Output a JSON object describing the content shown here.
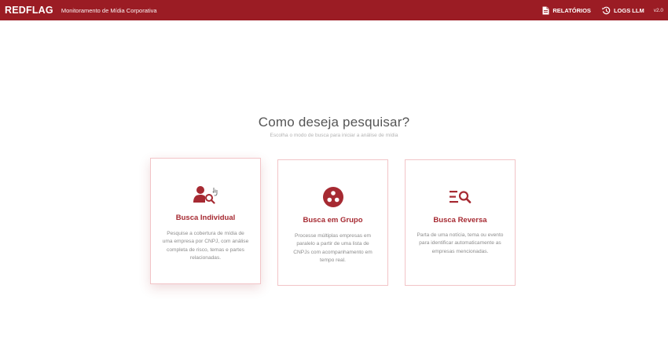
{
  "header": {
    "logo": "REDFLAG",
    "subtitle": "Monitoramento de Mídia Corporativa",
    "nav": [
      {
        "label": "RELATÓRIOS",
        "icon": "document-icon"
      },
      {
        "label": "LOGS LLM",
        "icon": "history-icon"
      }
    ],
    "version": "v2.0"
  },
  "main": {
    "title": "Como deseja pesquisar?",
    "subtitle": "Escolha o modo de busca para iniciar a análise de mídia"
  },
  "cards": [
    {
      "title": "Busca Individual",
      "description": "Pesquise a cobertura de mídia de uma empresa por CNPJ, com análise completa de risco, temas e partes relacionadas.",
      "icon": "user-search-icon"
    },
    {
      "title": "Busca em Grupo",
      "description": "Processe múltiplas empresas em paralelo a partir de uma lista de CNPJs com acompanhamento em tempo real.",
      "icon": "group-circle-icon"
    },
    {
      "title": "Busca Reversa",
      "description": "Parta de uma notícia, tema ou evento para identificar automaticamente as empresas mencionadas.",
      "icon": "list-search-icon"
    }
  ],
  "colors": {
    "brand": "#9b1c24",
    "accent": "#a62a32",
    "card_border": "#f2c4c7"
  }
}
